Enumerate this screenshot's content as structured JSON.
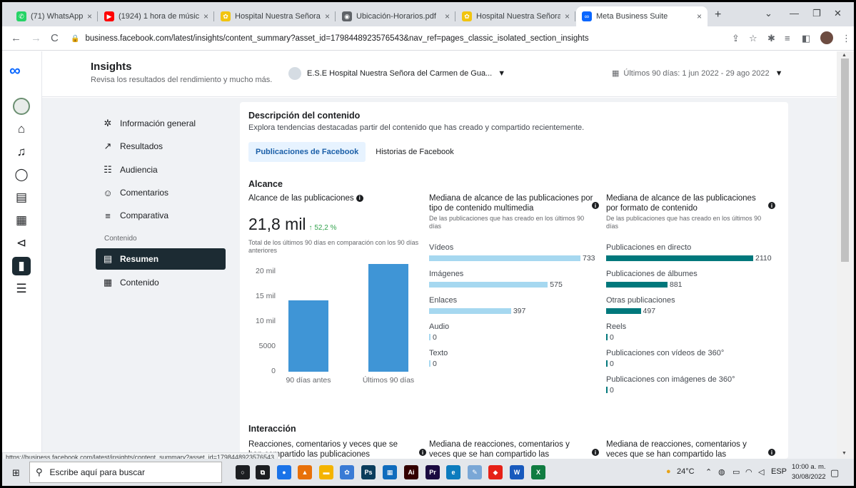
{
  "browser": {
    "tabs": [
      {
        "title": "(71) WhatsApp",
        "color": "#25d366",
        "glyph": "✆"
      },
      {
        "title": "(1924) 1 hora de músic",
        "color": "#ff0000",
        "glyph": "▶"
      },
      {
        "title": "Hospital Nuestra Señora de",
        "color": "#f1c40f",
        "glyph": "✿"
      },
      {
        "title": "Ubicación-Horarios.pdf",
        "color": "#5f6368",
        "glyph": "◉"
      },
      {
        "title": "Hospital Nuestra Señora de",
        "color": "#f1c40f",
        "glyph": "✿"
      },
      {
        "title": "Meta Business Suite",
        "color": "#0866ff",
        "glyph": "∞"
      }
    ],
    "url": "business.facebook.com/latest/insights/content_summary?asset_id=1798448923576543&nav_ref=pages_classic_isolated_section_insights",
    "status_url": "https://business.facebook.com/latest/insights/content_summary?asset_id=1798448923576543"
  },
  "header": {
    "title": "Insights",
    "subtitle": "Revisa los resultados del rendimiento y mucho más.",
    "asset": "E.S.E Hospital Nuestra Señora del Carmen de Gua...",
    "date_range": "Últimos 90 días: 1 jun 2022 - 29 ago 2022"
  },
  "nav": {
    "items": [
      {
        "label": "Información general",
        "icon": "✲"
      },
      {
        "label": "Resultados",
        "icon": "↗"
      },
      {
        "label": "Audiencia",
        "icon": "☷"
      },
      {
        "label": "Comentarios",
        "icon": "☺"
      },
      {
        "label": "Comparativa",
        "icon": "≡"
      }
    ],
    "section": "Contenido",
    "sub_items": [
      {
        "label": "Resumen",
        "icon": "▤"
      },
      {
        "label": "Contenido",
        "icon": "▦"
      }
    ]
  },
  "card": {
    "title": "Descripción del contenido",
    "subtitle": "Explora tendencias destacadas partir del contenido que has creado y compartido recientemente.",
    "tabs": [
      "Publicaciones de Facebook",
      "Historias de Facebook"
    ],
    "reach_section": "Alcance",
    "reach_title": "Alcance de las publicaciones",
    "reach_value": "21,8 mil",
    "reach_delta": "↑ 52,2 %",
    "reach_compare": "Total de los últimos 90 días en comparación con los 90 días anteriores",
    "media_title": "Mediana de alcance de las publicaciones por tipo de contenido multimedia",
    "media_desc": "De las publicaciones que has creado en los últimos 90 días",
    "format_title": "Mediana de alcance de las publicaciones por formato de contenido",
    "format_desc": "De las publicaciones que has creado en los últimos 90 días",
    "interaction_section": "Interacción",
    "int_col1": "Reacciones, comentarios y veces que se han compartido las publicaciones",
    "int_col2": "Mediana de reacciones, comentarios y veces que se han compartido las publicaciones por tipo de contenido multimedia",
    "int_col3": "Mediana de reacciones, comentarios y veces que se han compartido las publicaciones por tipo de formato de contenido"
  },
  "chart_data": [
    {
      "type": "bar",
      "title": "Alcance de las publicaciones",
      "categories": [
        "90 días antes",
        "Últimos 90 días"
      ],
      "values": [
        14300,
        21800
      ],
      "ylim": [
        0,
        20000
      ],
      "yticks": [
        "20 mil",
        "15 mil",
        "10 mil",
        "5000",
        "0"
      ],
      "color": "#3f95d6"
    },
    {
      "type": "bar",
      "orientation": "horizontal",
      "title": "Mediana de alcance de las publicaciones por tipo de contenido multimedia",
      "categories": [
        "Vídeos",
        "Imágenes",
        "Enlaces",
        "Audio",
        "Texto"
      ],
      "values": [
        733,
        575,
        397,
        0,
        0
      ],
      "color": "#a6d8f0"
    },
    {
      "type": "bar",
      "orientation": "horizontal",
      "title": "Mediana de alcance de las publicaciones por formato de contenido",
      "categories": [
        "Publicaciones en directo",
        "Publicaciones de álbumes",
        "Otras publicaciones",
        "Reels",
        "Publicaciones con vídeos de 360°",
        "Publicaciones con imágenes de 360°"
      ],
      "values": [
        2110,
        881,
        497,
        0,
        0,
        0
      ],
      "color": "#00787c"
    }
  ],
  "taskbar": {
    "search_placeholder": "Escribe aquí para buscar",
    "weather": "24°C",
    "lang": "ESP",
    "time": "10:00 a. m.",
    "date": "30/08/2022"
  }
}
